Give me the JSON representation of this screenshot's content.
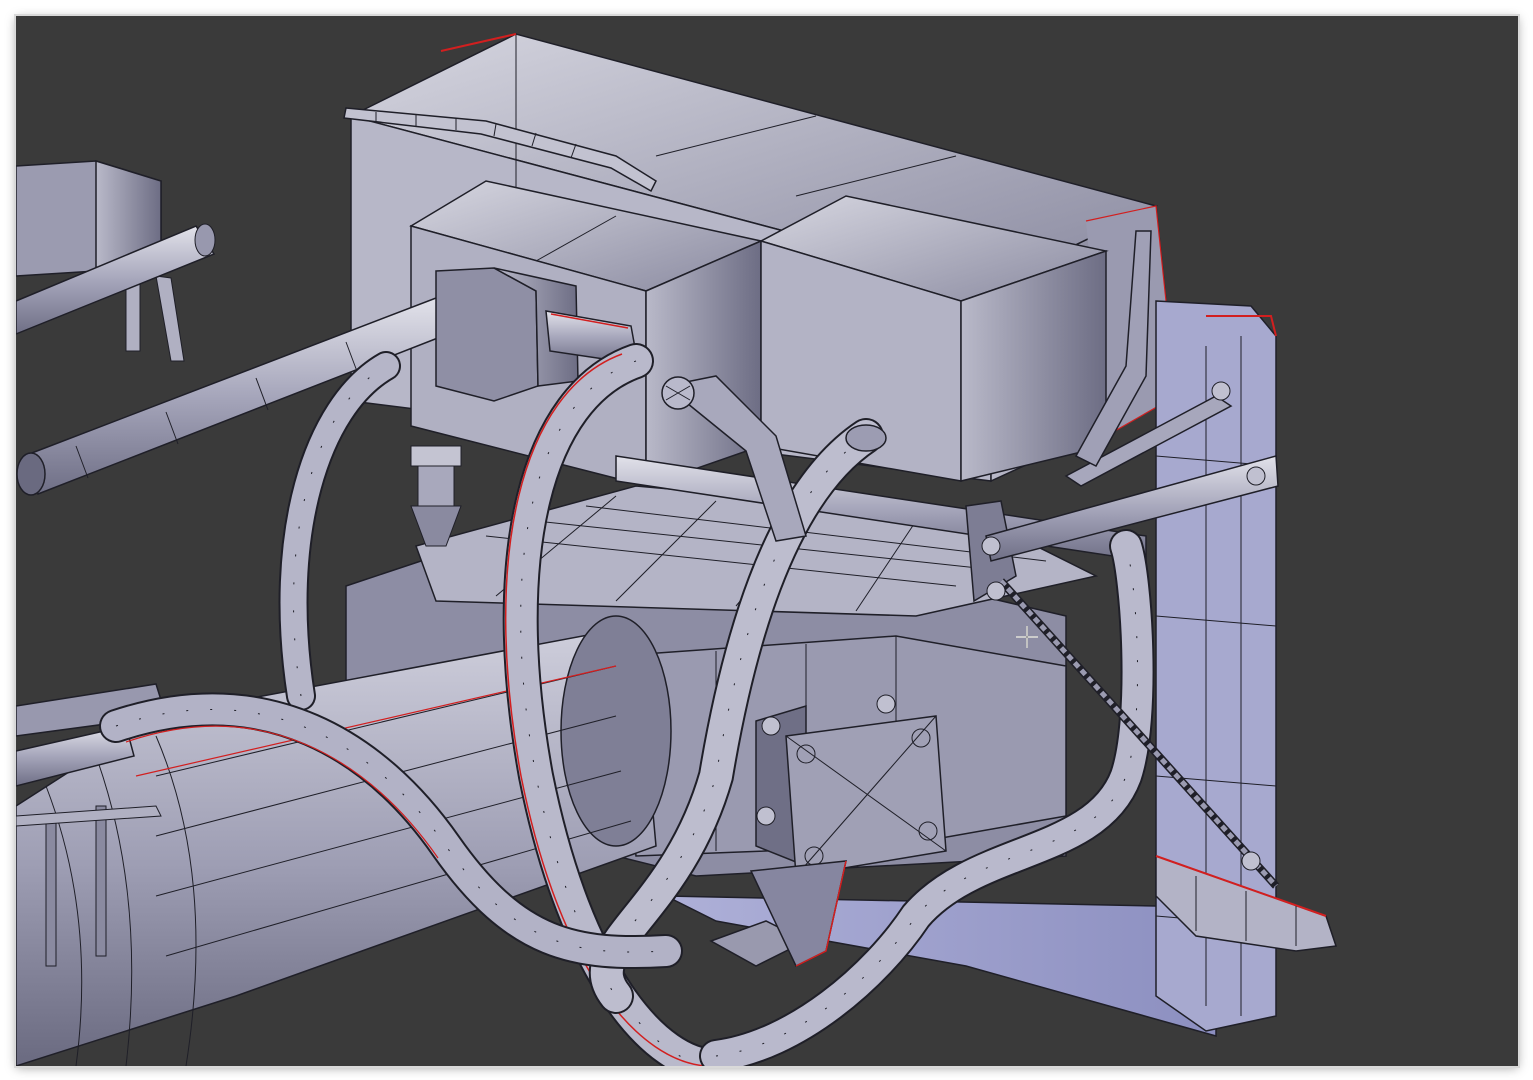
{
  "viewport": {
    "label": "",
    "colors": {
      "background": "#3a3a3a",
      "mesh_fill_light": "#c9c9d6",
      "mesh_fill_mid": "#a3a3b8",
      "mesh_fill_dark": "#6f6f84",
      "wire": "#1f1f28",
      "seam": "#d21f1f",
      "frame_border": "#d9d9d9"
    }
  },
  "icons": {
    "cursor": "crosshair-cursor-icon"
  }
}
